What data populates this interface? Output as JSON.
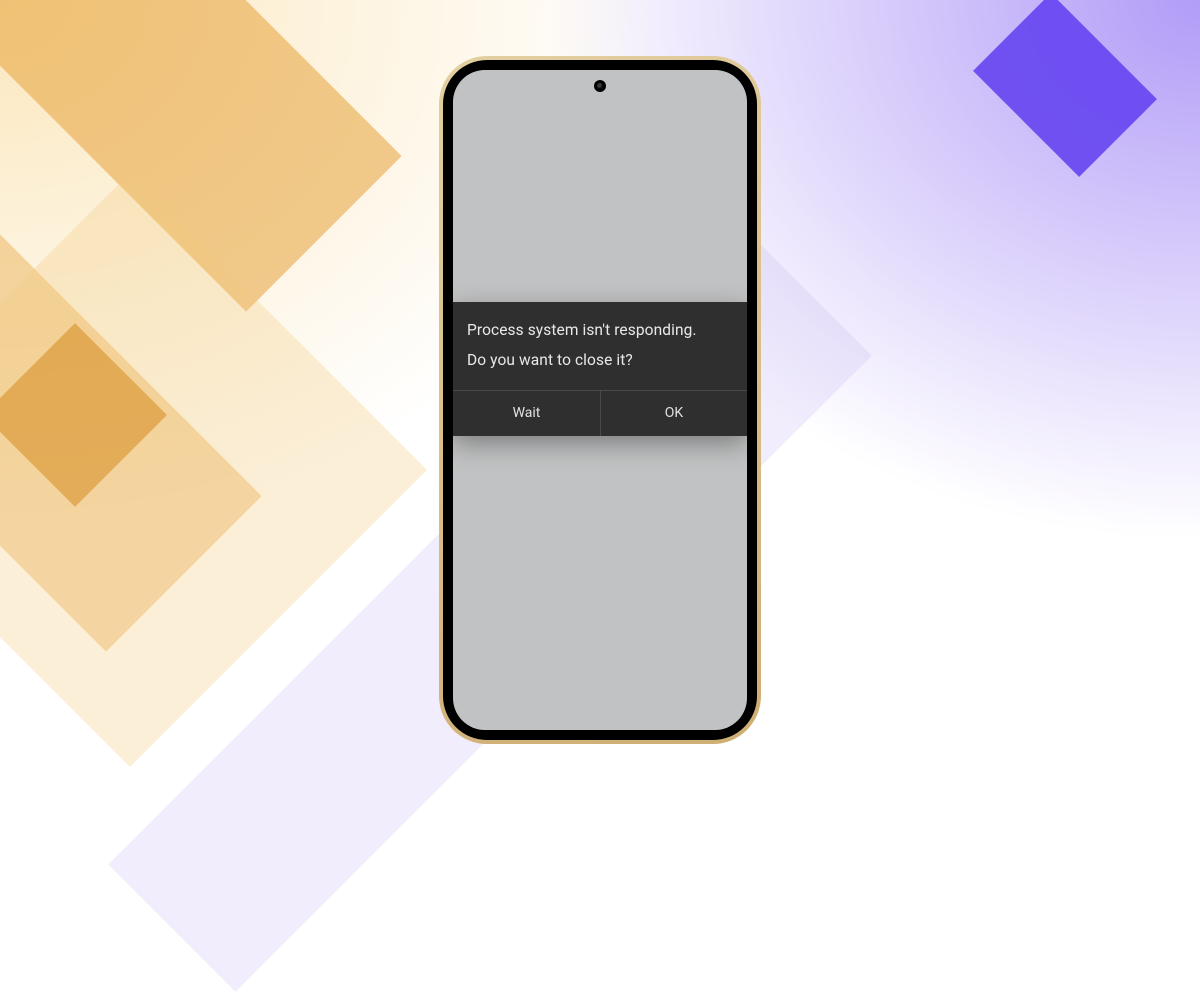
{
  "dialog": {
    "title": "Process system isn't responding.",
    "message": "Do you want to close it?",
    "wait_label": "Wait",
    "ok_label": "OK"
  }
}
